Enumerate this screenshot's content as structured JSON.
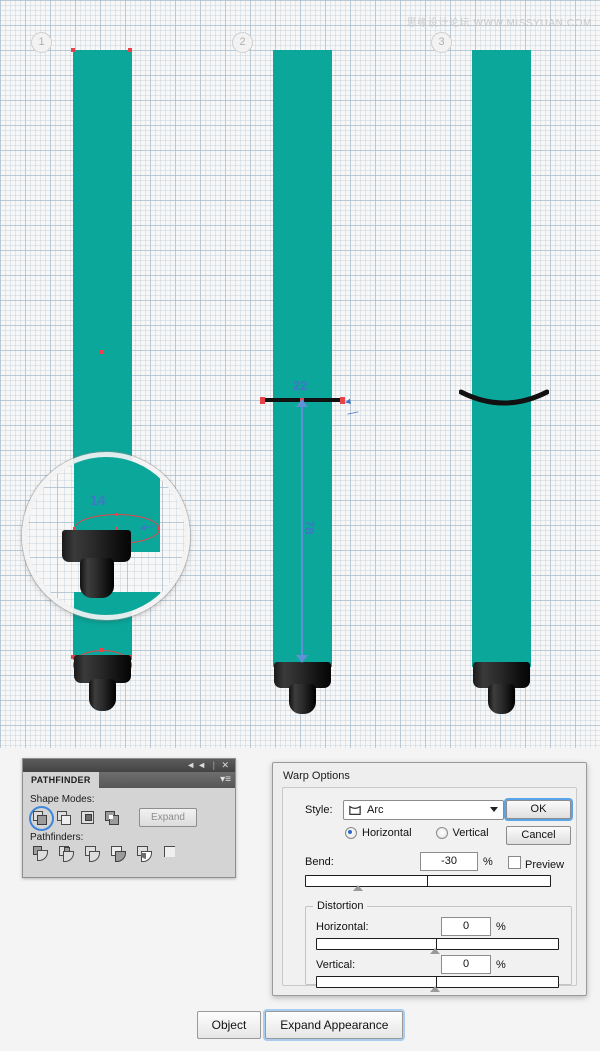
{
  "app": {
    "watermark": "思缘设计论坛  WWW.MISSYUAN.COM"
  },
  "canvas": {
    "steps": [
      {
        "number": "1"
      },
      {
        "number": "2"
      },
      {
        "number": "3"
      }
    ],
    "annotations": {
      "loupe_value": "14",
      "width_value": "22",
      "height_value": "78"
    },
    "colors": {
      "shape_fill": "#0ca79b",
      "anchor": "#e8424a",
      "measure_text": "#3f76c8",
      "stroke": "#111111"
    }
  },
  "pathfinder_panel": {
    "tab_label": "PATHFINDER",
    "collapse_label": "◄◄",
    "close_label": "✕",
    "menu_label": "▾≡",
    "shape_modes_label": "Shape Modes:",
    "pathfinders_label": "Pathfinders:",
    "expand_label": "Expand",
    "shape_modes": [
      {
        "name": "unite",
        "selected": true
      },
      {
        "name": "minus-front",
        "selected": false
      },
      {
        "name": "intersect",
        "selected": false
      },
      {
        "name": "exclude",
        "selected": false
      }
    ],
    "pathfinders": [
      {
        "name": "divide"
      },
      {
        "name": "trim"
      },
      {
        "name": "merge"
      },
      {
        "name": "crop"
      },
      {
        "name": "outline"
      },
      {
        "name": "minus-back"
      }
    ]
  },
  "warp_dialog": {
    "title": "Warp Options",
    "style_label": "Style:",
    "style_value": "Arc",
    "orientation": {
      "horizontal_label": "Horizontal",
      "vertical_label": "Vertical",
      "selected": "Horizontal"
    },
    "bend_label": "Bend:",
    "bend_value": "-30",
    "percent_symbol": "%",
    "distortion_legend": "Distortion",
    "distortion_horizontal_label": "Horizontal:",
    "distortion_horizontal_value": "0",
    "distortion_vertical_label": "Vertical:",
    "distortion_vertical_value": "0",
    "ok_label": "OK",
    "cancel_label": "Cancel",
    "preview_label": "Preview",
    "preview_checked": false
  },
  "bottom_bar": {
    "object_label": "Object",
    "expand_appearance_label": "Expand Appearance"
  }
}
